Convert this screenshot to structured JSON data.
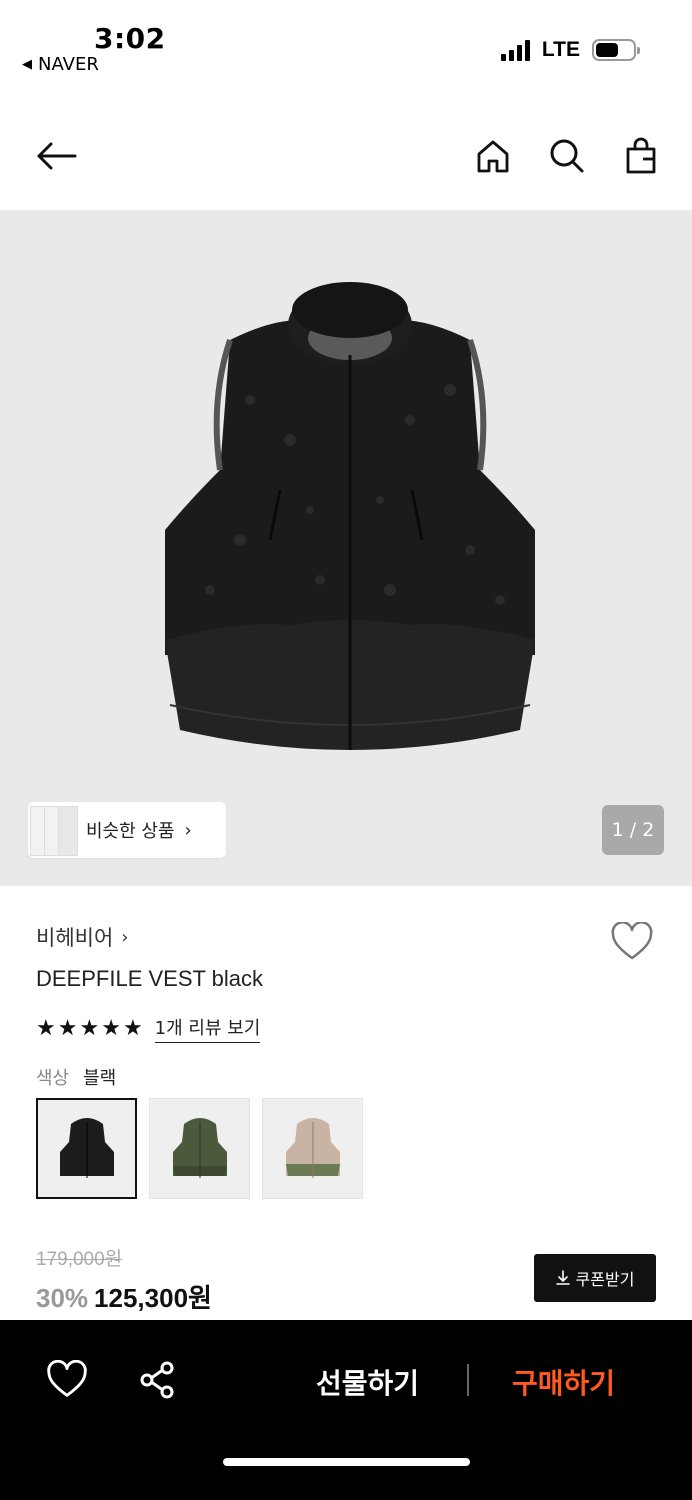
{
  "status_bar": {
    "time": "3:02",
    "back_app": "NAVER",
    "network": "LTE"
  },
  "nav": {
    "icons": [
      "back-arrow-icon",
      "home-icon",
      "search-icon",
      "shopping-bag-icon"
    ]
  },
  "gallery": {
    "similar_label": "비슷한 상품",
    "page_indicator": "1 / 2"
  },
  "product": {
    "brand": "비헤비어",
    "name": "DEEPFILE VEST black",
    "rating_stars": 5,
    "review_link": "1개 리뷰 보기",
    "color_label": "색상",
    "color_value": "블랙",
    "swatches": [
      {
        "name": "black",
        "color": "#1c1c1c"
      },
      {
        "name": "olive",
        "color": "#4b5a3c"
      },
      {
        "name": "beige",
        "color": "#c9b4a3"
      }
    ],
    "original_price": "179,000원",
    "discount": "30%",
    "price": "125,300원",
    "coupon_label": "쿠폰받기"
  },
  "bottom_bar": {
    "gift_label": "선물하기",
    "buy_label": "구매하기",
    "buy_color": "#ff5a1f"
  }
}
